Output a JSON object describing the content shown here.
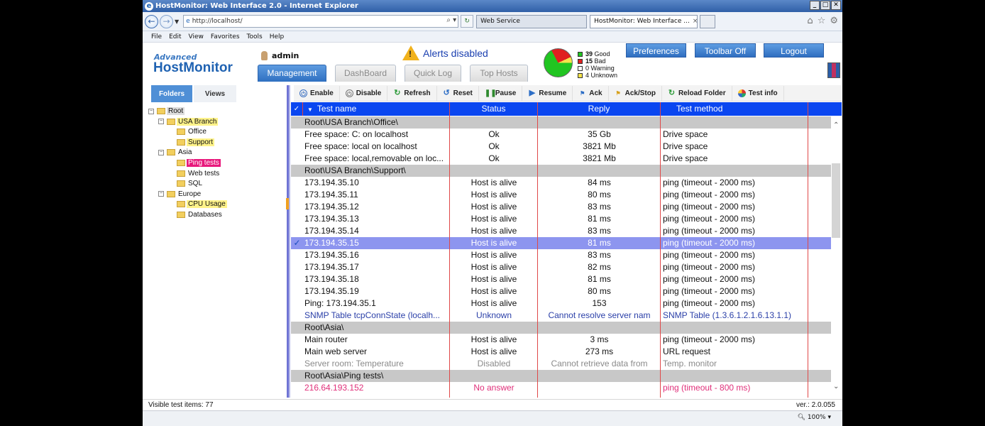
{
  "window": {
    "title": "HostMonitor: Web Interface 2.0 - Internet Explorer"
  },
  "browser": {
    "url": "http://localhost/",
    "tabs": [
      {
        "label": "Web Service"
      },
      {
        "label": "HostMonitor: Web Interface ...",
        "close": "×"
      }
    ],
    "menu": [
      "File",
      "Edit",
      "View",
      "Favorites",
      "Tools",
      "Help"
    ],
    "zoom": "100%"
  },
  "app": {
    "logo_top": "Advanced",
    "logo_main": "HostMonitor",
    "user": "admin",
    "alert": "Alerts disabled",
    "tabs": [
      "Management",
      "DashBoard",
      "Quick Log",
      "Top Hosts"
    ],
    "header_buttons": [
      "Preferences",
      "Toolbar Off",
      "Logout"
    ],
    "stats": [
      {
        "count": "39",
        "label": "Good",
        "color": "#21c521"
      },
      {
        "count": "15",
        "label": "Bad",
        "color": "#e02020"
      },
      {
        "count": "0",
        "label": "Warning",
        "color": "#ffffff"
      },
      {
        "count": "4",
        "label": "Unknown",
        "color": "#f5e34a"
      }
    ],
    "side_tabs": [
      "Folders",
      "Views"
    ],
    "toolbar": [
      "Enable",
      "Disable",
      "Refresh",
      "Reset",
      "Pause",
      "Resume",
      "Ack",
      "Ack/Stop",
      "Reload Folder",
      "Test info"
    ],
    "columns": [
      "Test name",
      "Status",
      "Reply",
      "Test method"
    ],
    "status_left": "Visible test items: 77",
    "version": "ver.: 2.0.055"
  },
  "tree": [
    {
      "label": "Root",
      "level": 0,
      "hl": "g",
      "pm": "−"
    },
    {
      "label": "USA Branch",
      "level": 1,
      "hl": "y",
      "pm": "−"
    },
    {
      "label": "Office",
      "level": 2,
      "hl": ""
    },
    {
      "label": "Support",
      "level": 2,
      "hl": "y"
    },
    {
      "label": "Asia",
      "level": 1,
      "hl": "",
      "pm": "−"
    },
    {
      "label": "Ping tests",
      "level": 2,
      "hl": "p"
    },
    {
      "label": "Web tests",
      "level": 2,
      "hl": ""
    },
    {
      "label": "SQL",
      "level": 2,
      "hl": ""
    },
    {
      "label": "Europe",
      "level": 1,
      "hl": "",
      "pm": "−"
    },
    {
      "label": "CPU Usage",
      "level": 2,
      "hl": "y"
    },
    {
      "label": "Databases",
      "level": 2,
      "hl": ""
    }
  ],
  "rows": [
    {
      "type": "grp",
      "name": "Root\\USA Branch\\Office\\"
    },
    {
      "name": "Free space: C: on localhost",
      "status": "Ok",
      "reply": "35 Gb",
      "method": "Drive space"
    },
    {
      "name": "Free space: local on localhost",
      "status": "Ok",
      "reply": "3821 Mb",
      "method": "Drive space"
    },
    {
      "name": "Free space: local,removable on loc...",
      "status": "Ok",
      "reply": "3821 Mb",
      "method": "Drive space"
    },
    {
      "type": "grp",
      "name": "Root\\USA Branch\\Support\\"
    },
    {
      "name": "173.194.35.10",
      "status": "Host is alive",
      "reply": "84 ms",
      "method": "ping (timeout - 2000 ms)"
    },
    {
      "name": "173.194.35.11",
      "status": "Host is alive",
      "reply": "80 ms",
      "method": "ping (timeout - 2000 ms)"
    },
    {
      "name": "173.194.35.12",
      "status": "Host is alive",
      "reply": "83 ms",
      "method": "ping (timeout - 2000 ms)"
    },
    {
      "name": "173.194.35.13",
      "status": "Host is alive",
      "reply": "81 ms",
      "method": "ping (timeout - 2000 ms)"
    },
    {
      "name": "173.194.35.14",
      "status": "Host is alive",
      "reply": "83 ms",
      "method": "ping (timeout - 2000 ms)"
    },
    {
      "type": "sel",
      "mark": "✓",
      "name": "173.194.35.15",
      "status": "Host is alive",
      "reply": "81 ms",
      "method": "ping (timeout - 2000 ms)"
    },
    {
      "name": "173.194.35.16",
      "status": "Host is alive",
      "reply": "83 ms",
      "method": "ping (timeout - 2000 ms)"
    },
    {
      "name": "173.194.35.17",
      "status": "Host is alive",
      "reply": "82 ms",
      "method": "ping (timeout - 2000 ms)"
    },
    {
      "name": "173.194.35.18",
      "status": "Host is alive",
      "reply": "81 ms",
      "method": "ping (timeout - 2000 ms)"
    },
    {
      "name": "173.194.35.19",
      "status": "Host is alive",
      "reply": "80 ms",
      "method": "ping (timeout - 2000 ms)"
    },
    {
      "name": "Ping: 173.194.35.1",
      "status": "Host is alive",
      "reply": "153",
      "method": "ping (timeout - 2000 ms)"
    },
    {
      "type": "blue",
      "name": "SNMP Table tcpConnState (localh...",
      "status": "Unknown",
      "reply": "Cannot resolve server nam",
      "method": "SNMP Table (1.3.6.1.2.1.6.13.1.1)"
    },
    {
      "type": "grp",
      "name": "Root\\Asia\\"
    },
    {
      "name": "Main router",
      "status": "Host is alive",
      "reply": "3 ms",
      "method": "ping (timeout - 2000 ms)"
    },
    {
      "name": "Main web server",
      "status": "Host is alive",
      "reply": "273 ms",
      "method": "URL request"
    },
    {
      "type": "gray",
      "name": "Server room: Temperature",
      "status": "Disabled",
      "reply": "Cannot retrieve data from",
      "method": "Temp. monitor"
    },
    {
      "type": "grp",
      "name": "Root\\Asia\\Ping tests\\"
    },
    {
      "type": "pink",
      "name": "216.64.193.152",
      "status": "No answer",
      "reply": "",
      "method": "ping (timeout - 800 ms)"
    }
  ]
}
